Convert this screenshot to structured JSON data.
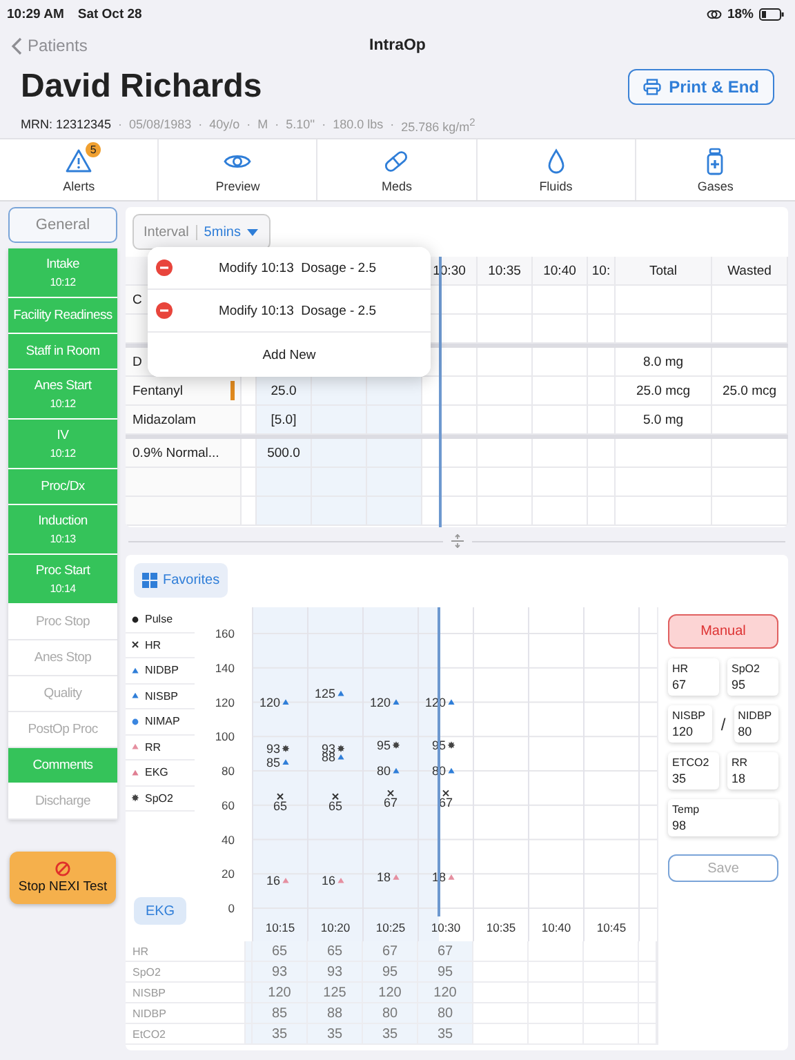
{
  "status_bar": {
    "time": "10:29 AM",
    "date": "Sat Oct 28",
    "battery": "18%"
  },
  "nav": {
    "back": "Patients",
    "title": "IntraOp"
  },
  "patient": {
    "name": "David Richards",
    "mrn": "MRN: 12312345",
    "separator": "·",
    "details": [
      "05/08/1983",
      "40y/o",
      "M",
      "5.10''",
      "180.0 lbs",
      "25.786 kg/m$^{2}$"
    ],
    "action": "Print & End"
  },
  "toolbar": [
    {
      "label": "Alerts",
      "badge": "5"
    },
    {
      "label": "Preview"
    },
    {
      "label": "Meds"
    },
    {
      "label": "Fluids"
    },
    {
      "label": "Gases"
    }
  ],
  "sidebar": {
    "header": "General",
    "items": [
      {
        "label": "Intake",
        "time": "10:12",
        "completed": true
      },
      {
        "label": "Facility Readiness",
        "completed": true
      },
      {
        "label": "Staff in Room",
        "completed": true
      },
      {
        "label": "Anes Start",
        "time": "10:12",
        "completed": true
      },
      {
        "label": "IV",
        "time": "10:12",
        "completed": true
      },
      {
        "label": "Proc/Dx",
        "completed": true
      },
      {
        "label": "Induction",
        "time": "10:13",
        "completed": true
      },
      {
        "label": "Proc Start",
        "time": "10:14",
        "completed": true
      },
      {
        "label": "Proc Stop",
        "completed": false
      },
      {
        "label": "Anes Stop",
        "completed": false
      },
      {
        "label": "Quality",
        "completed": false
      },
      {
        "label": "PostOp Proc",
        "completed": false
      },
      {
        "label": "Comments",
        "completed": true
      },
      {
        "label": "Discharge",
        "completed": false
      }
    ],
    "stop_button": "Stop NEXI Test"
  },
  "meds_grid": {
    "interval_label": "Interval",
    "interval_value": "5mins",
    "popover": {
      "entries": [
        "Modify 10:13  Dosage - 2.5",
        "Modify 10:13  Dosage - 2.5"
      ],
      "add": "Add New"
    },
    "time_columns": [
      "10:30",
      "10:35",
      "10:40",
      "10:"
    ],
    "total_label": "Total",
    "wasted_label": "Wasted",
    "groups": [
      {
        "rows": [
          {
            "name": "C"
          },
          {}
        ]
      },
      {
        "rows": [
          {
            "name": "D",
            "total": "8.0 mg"
          },
          {
            "name": "Fentanyl",
            "dose": "25.0",
            "total": "25.0 mcg",
            "wasted": "25.0 mcg",
            "flagged": true
          },
          {
            "name": "Midazolam",
            "dose": "[5.0]",
            "total": "5.0 mg",
            "flagged": false
          }
        ]
      },
      {
        "rows": [
          {
            "name": "0.9% Normal...",
            "dose": "500.0",
            "flagged": false
          },
          {
            "flagged": false
          },
          {
            "flagged": false
          }
        ]
      }
    ]
  },
  "vitals": {
    "favorites": "Favorites",
    "ekg_button": "EKG",
    "chart_data": {
      "type": "scatter",
      "categories": [
        "10:15",
        "10:20",
        "10:25",
        "10:30",
        "10:35",
        "10:40",
        "10:45"
      ],
      "ylim": [
        0,
        160
      ],
      "yticks": [
        0,
        20,
        40,
        60,
        80,
        100,
        120,
        140,
        160
      ],
      "grid": true,
      "data_labels": true,
      "series": [
        {
          "name": "Pulse",
          "marker": "circle",
          "color": "#222222",
          "values": [
            null,
            null,
            null,
            null,
            null,
            null,
            null
          ]
        },
        {
          "name": "HR",
          "marker": "cross",
          "color": "#333333",
          "values": [
            65,
            65,
            67,
            67,
            null,
            null,
            null
          ]
        },
        {
          "name": "NIDBP",
          "marker": "triangle",
          "color": "#2f7ed8",
          "values": [
            85,
            88,
            80,
            80,
            null,
            null,
            null
          ]
        },
        {
          "name": "NISBP",
          "marker": "triangle",
          "color": "#2f7ed8",
          "values": [
            120,
            125,
            120,
            120,
            null,
            null,
            null
          ]
        },
        {
          "name": "NIMAP",
          "marker": "circle",
          "color": "#3b86e0",
          "values": [
            null,
            null,
            null,
            null,
            null,
            null,
            null
          ]
        },
        {
          "name": "RR",
          "marker": "triangle",
          "color": "#e58fa0",
          "values": [
            16,
            16,
            18,
            18,
            null,
            null,
            null
          ]
        },
        {
          "name": "EKG",
          "marker": "triangle",
          "color": "#e07f93",
          "values": [
            null,
            null,
            null,
            null,
            null,
            null,
            null
          ]
        },
        {
          "name": "SpO2",
          "marker": "star",
          "color": "#444444",
          "values": [
            93,
            93,
            95,
            95,
            null,
            null,
            null
          ]
        }
      ]
    },
    "entry": {
      "mode": "Manual",
      "rows": [
        {
          "fields": [
            {
              "label": "HR",
              "value": "67"
            },
            {
              "label": "SpO2",
              "value": "95"
            }
          ]
        },
        {
          "fields": [
            {
              "label": "NISBP",
              "value": "120"
            },
            {
              "label": "NIDBP",
              "value": "80"
            }
          ],
          "separator": "/"
        },
        {
          "fields": [
            {
              "label": "ETCO2",
              "value": "35"
            },
            {
              "label": "RR",
              "value": "18"
            }
          ]
        },
        {
          "fields": [
            {
              "label": "Temp",
              "value": "98"
            }
          ]
        }
      ],
      "save": "Save",
      "save_disabled": true
    },
    "table": [
      {
        "name": "HR",
        "values": [
          "65",
          "65",
          "67",
          "67"
        ]
      },
      {
        "name": "SpO2",
        "values": [
          "93",
          "93",
          "95",
          "95"
        ]
      },
      {
        "name": "NISBP",
        "values": [
          "120",
          "125",
          "120",
          "120"
        ]
      },
      {
        "name": "NIDBP",
        "values": [
          "85",
          "88",
          "80",
          "80"
        ]
      },
      {
        "name": "EtCO2",
        "values": [
          "35",
          "35",
          "35",
          "35"
        ]
      }
    ]
  }
}
